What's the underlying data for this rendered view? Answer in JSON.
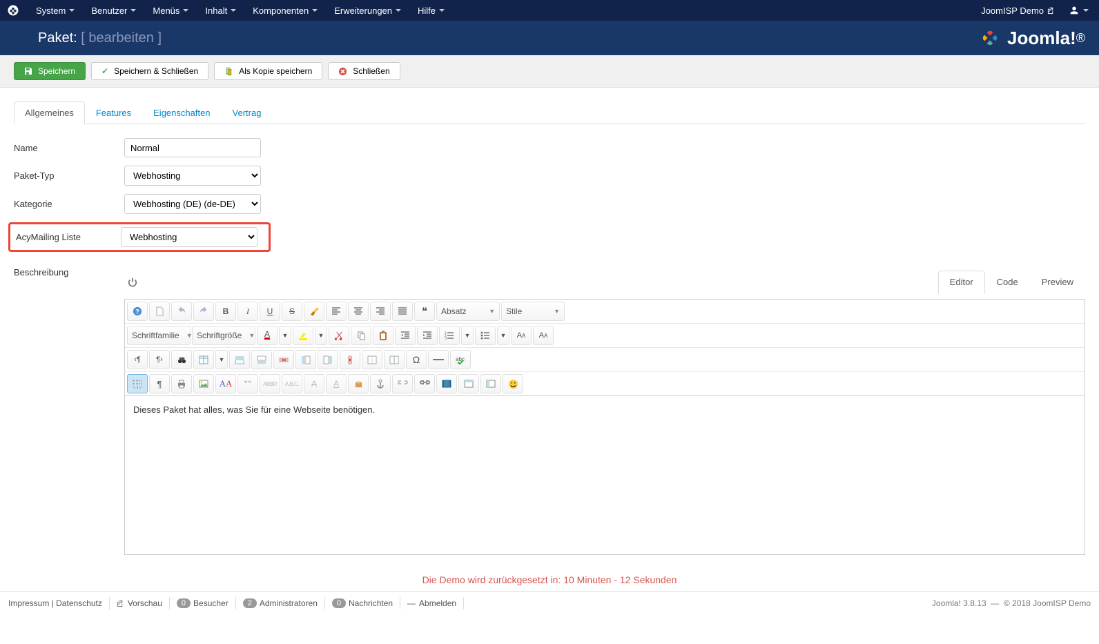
{
  "topmenu": {
    "system": "System",
    "users": "Benutzer",
    "menus": "Menüs",
    "content": "Inhalt",
    "components": "Komponenten",
    "extensions": "Erweiterungen",
    "help": "Hilfe"
  },
  "topright": {
    "sitename": "JoomISP Demo"
  },
  "title": {
    "main": "Paket:",
    "sub": "[ bearbeiten ]"
  },
  "brand": "Joomla!",
  "toolbar": {
    "save": "Speichern",
    "saveclose": "Speichern & Schließen",
    "savecopy": "Als Kopie speichern",
    "close": "Schließen"
  },
  "tabs": {
    "general": "Allgemeines",
    "features": "Features",
    "properties": "Eigenschaften",
    "contract": "Vertrag"
  },
  "form": {
    "name_label": "Name",
    "name_value": "Normal",
    "type_label": "Paket-Typ",
    "type_value": "Webhosting",
    "category_label": "Kategorie",
    "category_value": "Webhosting (DE) (de-DE)",
    "acy_label": "AcyMailing Liste",
    "acy_value": "Webhosting",
    "desc_label": "Beschreibung"
  },
  "editor_tabs": {
    "editor": "Editor",
    "code": "Code",
    "preview": "Preview"
  },
  "editor_selects": {
    "paragraph": "Absatz",
    "styles": "Stile",
    "fontfamily": "Schriftfamilie",
    "fontsize": "Schriftgröße"
  },
  "editor_content": "Dieses Paket hat alles, was Sie für eine Webseite benötigen.",
  "demo_banner": "Die Demo wird zurückgesetzt in: 10 Minuten - 12 Sekunden",
  "footer": {
    "impressum": "Impressum",
    "datenschutz": "Datenschutz",
    "vorschau": "Vorschau",
    "visitors_count": "0",
    "visitors": "Besucher",
    "admins_count": "2",
    "admins": "Administratoren",
    "messages_count": "0",
    "messages": "Nachrichten",
    "logout": "Abmelden",
    "version": "Joomla! 3.8.13",
    "copyright": "© 2018 JoomISP Demo"
  }
}
